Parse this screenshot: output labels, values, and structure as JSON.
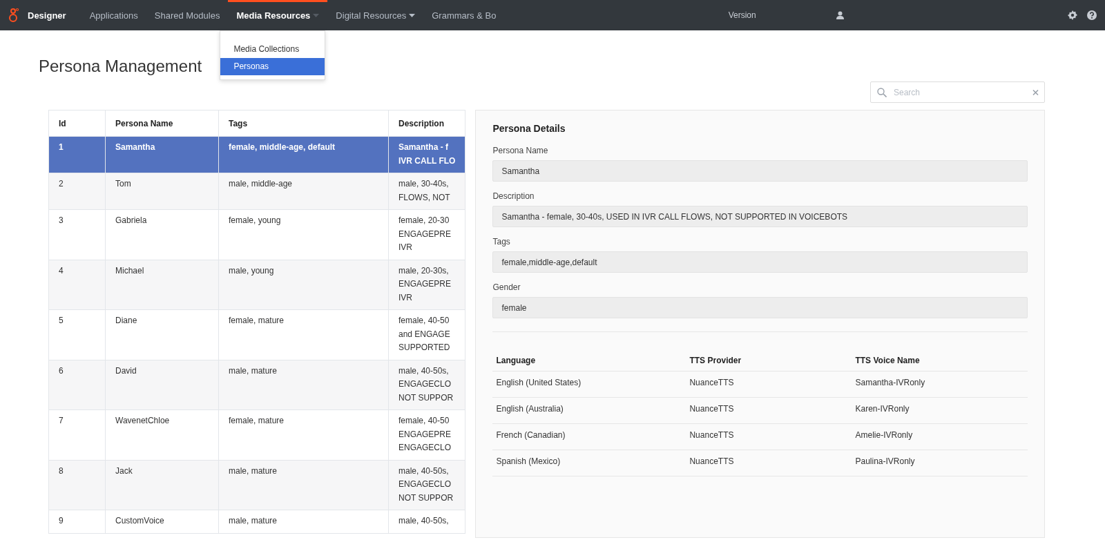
{
  "nav": {
    "brand": "Designer",
    "items": [
      {
        "label": "Applications",
        "selected": false,
        "caret": false
      },
      {
        "label": "Shared Modules",
        "selected": false,
        "caret": false
      },
      {
        "label": "Media Resources",
        "selected": true,
        "caret": true
      },
      {
        "label": "Digital Resources",
        "selected": false,
        "caret": true
      },
      {
        "label": "Grammars & Bo",
        "selected": false,
        "caret": false
      }
    ],
    "version": "Version",
    "dropdown": [
      {
        "label": "Media Collections",
        "selected": false
      },
      {
        "label": "Personas",
        "selected": true
      }
    ]
  },
  "page_title": "Persona Management",
  "search": {
    "placeholder": "Search"
  },
  "table": {
    "columns": [
      "Id",
      "Persona Name",
      "Tags",
      "Description"
    ],
    "rows": [
      {
        "id": "1",
        "name": "Samantha",
        "tags": "female, middle-age, default",
        "description": [
          "Samantha - f",
          "IVR CALL FLO"
        ],
        "selected": true
      },
      {
        "id": "2",
        "name": "Tom",
        "tags": "male, middle-age",
        "description": [
          "male, 30-40s,",
          "FLOWS, NOT"
        ],
        "selected": false
      },
      {
        "id": "3",
        "name": "Gabriela",
        "tags": "female, young",
        "description": [
          "female, 20-30",
          "ENGAGEPRE",
          "IVR"
        ],
        "selected": false
      },
      {
        "id": "4",
        "name": "Michael",
        "tags": "male, young",
        "description": [
          "male, 20-30s,",
          "ENGAGEPRE",
          "IVR"
        ],
        "selected": false
      },
      {
        "id": "5",
        "name": "Diane",
        "tags": "female, mature",
        "description": [
          "female, 40-50",
          "and ENGAGE",
          "SUPPORTED"
        ],
        "selected": false
      },
      {
        "id": "6",
        "name": "David",
        "tags": "male, mature",
        "description": [
          "male, 40-50s,",
          "ENGAGECLO",
          "NOT SUPPOR"
        ],
        "selected": false
      },
      {
        "id": "7",
        "name": "WavenetChloe",
        "tags": "female, mature",
        "description": [
          "female, 40-50",
          "ENGAGEPRE",
          "ENGAGECLO"
        ],
        "selected": false
      },
      {
        "id": "8",
        "name": "Jack",
        "tags": "male, mature",
        "description": [
          "male, 40-50s,",
          "ENGAGECLO",
          "NOT SUPPOR"
        ],
        "selected": false
      },
      {
        "id": "9",
        "name": "CustomVoice",
        "tags": "male, mature",
        "description": [
          "male, 40-50s,"
        ],
        "selected": false
      }
    ]
  },
  "details": {
    "title": "Persona Details",
    "fields": [
      {
        "label": "Persona Name",
        "value": "Samantha"
      },
      {
        "label": "Description",
        "value": "Samantha - female, 30-40s, USED IN IVR CALL FLOWS, NOT SUPPORTED IN VOICEBOTS"
      },
      {
        "label": "Tags",
        "value": "female,middle-age,default"
      },
      {
        "label": "Gender",
        "value": "female"
      }
    ],
    "voices": {
      "columns": [
        "Language",
        "TTS Provider",
        "TTS Voice Name"
      ],
      "rows": [
        [
          "English (United States)",
          "NuanceTTS",
          "Samantha-IVRonly"
        ],
        [
          "English (Australia)",
          "NuanceTTS",
          "Karen-IVRonly"
        ],
        [
          "French (Canadian)",
          "NuanceTTS",
          "Amelie-IVRonly"
        ],
        [
          "Spanish (Mexico)",
          "NuanceTTS",
          "Paulina-IVRonly"
        ]
      ]
    }
  }
}
